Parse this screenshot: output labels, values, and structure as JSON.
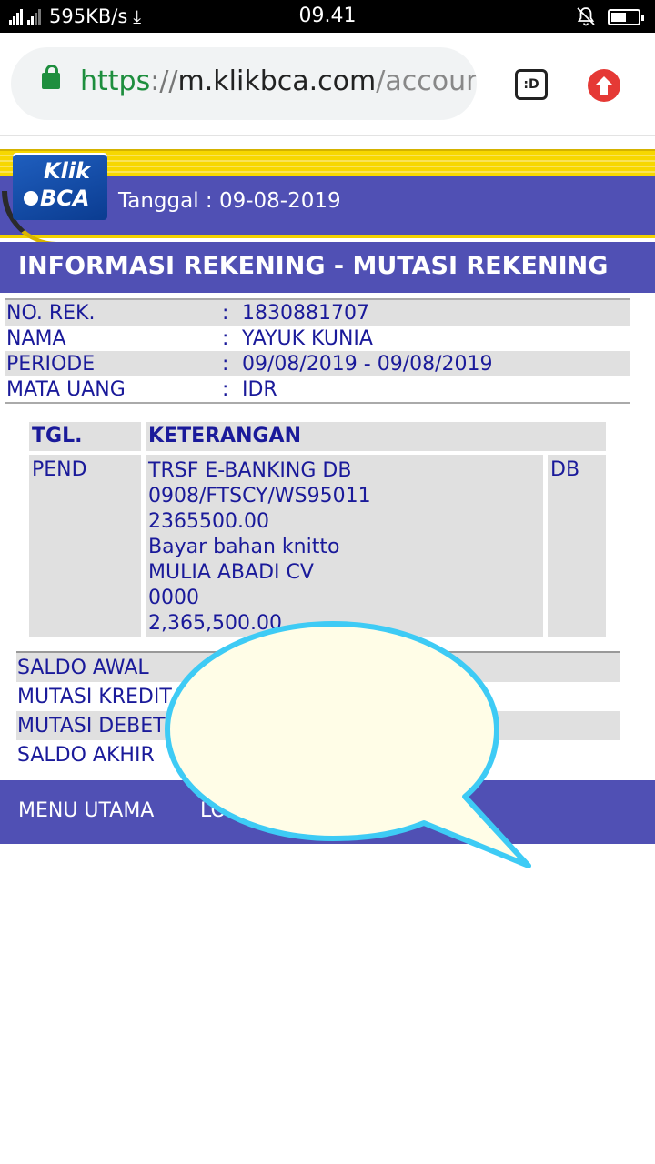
{
  "statusbar": {
    "speed": "595KB/s",
    "time": "09.41"
  },
  "browser": {
    "url_scheme": "https",
    "url_sep": "://",
    "url_host": "m.klikbca.com",
    "url_path": "/accoun",
    "tab_label": ":D"
  },
  "header": {
    "logo_line1": "Klik",
    "logo_line2": "BCA",
    "tanggal": "Tanggal : 09-08-2019",
    "title": "INFORMASI REKENING - MUTASI REKENING"
  },
  "account": {
    "rows": [
      {
        "label": "NO. REK.",
        "colon": ":",
        "value": "1830881707"
      },
      {
        "label": "NAMA",
        "colon": ":",
        "value": "YAYUK KUNIA"
      },
      {
        "label": "PERIODE",
        "colon": ":",
        "value": "09/08/2019 - 09/08/2019"
      },
      {
        "label": "MATA UANG",
        "colon": ":",
        "value": "IDR"
      }
    ]
  },
  "transactions": {
    "headers": {
      "date": "TGL.",
      "desc": "KETERANGAN"
    },
    "rows": [
      {
        "date": "PEND",
        "desc": [
          "TRSF E-BANKING DB",
          "0908/FTSCY/WS95011",
          "2365500.00",
          "Bayar bahan knitto",
          "MULIA ABADI CV",
          "0000",
          "2,365,500.00"
        ],
        "type": "DB"
      }
    ]
  },
  "summary": {
    "rows": [
      "SALDO AWAL",
      "MUTASI KREDIT",
      "MUTASI DEBET",
      "SALDO AKHIR"
    ]
  },
  "footer": {
    "menu_utama": "MENU UTAMA",
    "logout_partial": "LO"
  },
  "colors": {
    "brand_blue": "#5050b4",
    "text_blue": "#1a1a9a",
    "gold": "#f7d700",
    "bubble_fill": "#fffde7",
    "bubble_stroke": "#3ecbf5"
  }
}
